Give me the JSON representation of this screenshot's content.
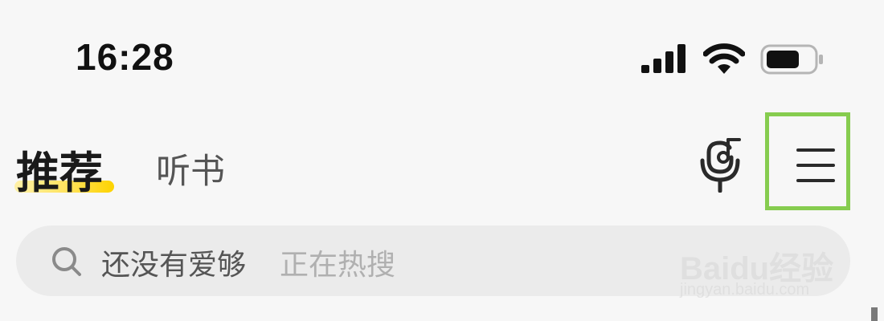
{
  "status_bar": {
    "time": "16:28",
    "icons": [
      "signal-icon",
      "wifi-icon",
      "battery-icon"
    ]
  },
  "tabs": [
    {
      "label": "推荐",
      "active": true
    },
    {
      "label": "听书",
      "active": false
    }
  ],
  "header_icons": {
    "voice": "voice-search-icon",
    "menu": "menu-icon"
  },
  "search": {
    "value": "还没有爱够",
    "hint": "正在热搜",
    "icon": "search-icon"
  },
  "watermark": {
    "brand": "Baidu经验",
    "url": "jingyan.baidu.com"
  },
  "colors": {
    "highlight_box": "#86cc4f",
    "tab_underline": "#fdd300",
    "search_bg": "#ebebeb"
  }
}
